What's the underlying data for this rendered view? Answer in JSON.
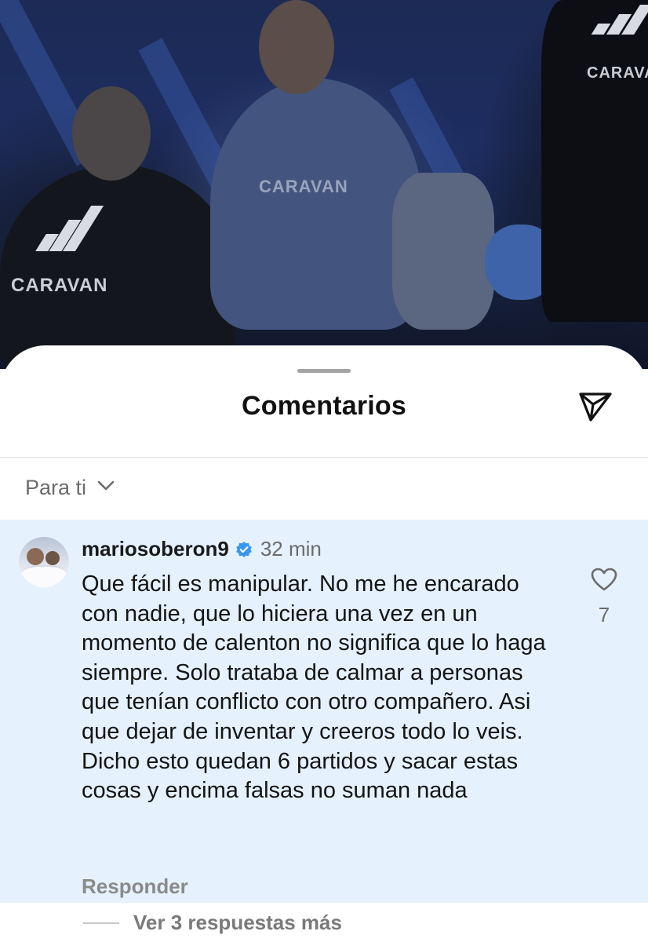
{
  "background_photo": {
    "brand_left": "CARAVAN",
    "brand_center": "CARAVAN",
    "brand_right": "CARAVAN"
  },
  "sheet": {
    "title": "Comentarios",
    "share_icon": "paper-plane-icon",
    "sort": {
      "label": "Para ti",
      "icon": "chevron-down-icon"
    }
  },
  "comment": {
    "username": "mariosoberon9",
    "verified_icon": "verified-badge-icon",
    "time_ago": "32 min",
    "text": "Que fácil es manipular. No me he encarado con nadie, que lo hiciera una vez en un momento de calenton no significa que lo haga siempre. Solo trataba de calmar a personas que tenían conflicto con otro compañero. Asi que dejar de inventar y creeros todo lo veis. Dicho esto quedan 6 partidos y sacar estas cosas y encima falsas no suman nada",
    "reply_label": "Responder",
    "like_icon": "heart-outline-icon",
    "like_count": "7",
    "highlight_color": "#e5f1fd"
  },
  "replies": {
    "label": "Ver 3 respuestas más"
  },
  "colors": {
    "verified_blue": "#3797f0",
    "secondary_text": "#6b6b6b"
  }
}
